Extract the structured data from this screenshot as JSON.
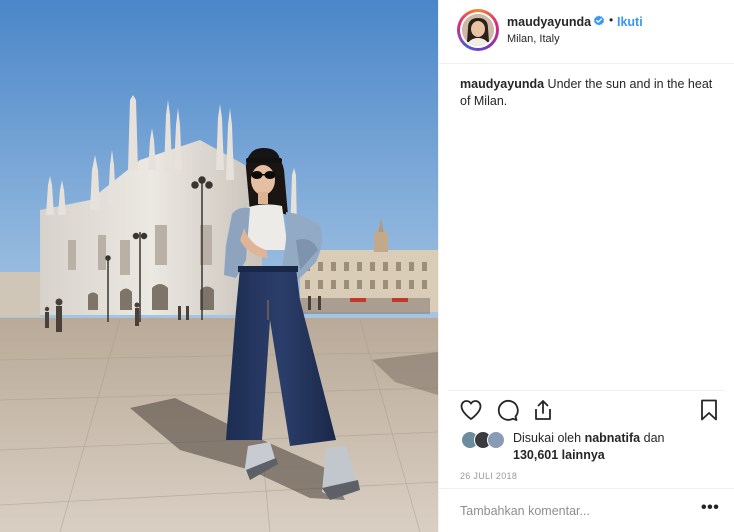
{
  "post": {
    "image_alt": "Woman in cap, sunglasses, denim jacket and wide-leg jeans in front of Milan Cathedral"
  },
  "header": {
    "username": "maudyayunda",
    "verified": true,
    "dot": "•",
    "follow_label": "Ikuti",
    "location": "Milan, Italy"
  },
  "caption": {
    "username": "maudyayunda",
    "text": "Under the sun and in the heat of Milan."
  },
  "actions": {
    "like_icon": "heart-icon",
    "comment_icon": "comment-icon",
    "share_icon": "share-icon",
    "save_icon": "bookmark-icon"
  },
  "likes": {
    "prefix": "Disukai oleh",
    "user": "nabnatifa",
    "conj": "dan",
    "count_text": "130,601 lainnya"
  },
  "date": "26 JULI 2018",
  "comment": {
    "placeholder": "Tambahkan komentar...",
    "more_label": "•••"
  },
  "colors": {
    "link_blue": "#3897f0",
    "verified_blue": "#3897f0",
    "text": "#262626",
    "muted": "#999999"
  }
}
